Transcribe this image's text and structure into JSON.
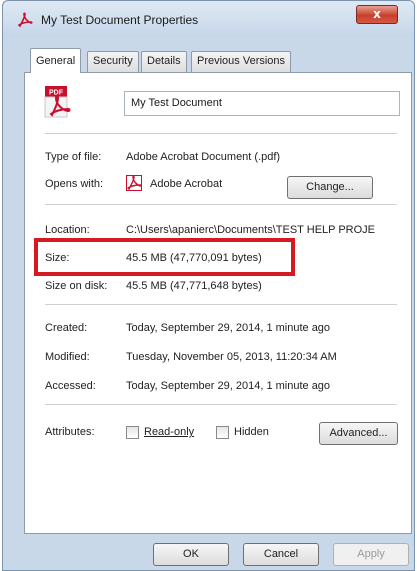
{
  "window": {
    "title": "My Test Document Properties",
    "close_glyph": "x"
  },
  "tabs": [
    {
      "label": "General",
      "active": true
    },
    {
      "label": "Security",
      "active": false
    },
    {
      "label": "Details",
      "active": false
    },
    {
      "label": "Previous Versions",
      "active": false
    }
  ],
  "general": {
    "file_name": "My Test Document",
    "file_icon": "pdf-file-icon",
    "type_label": "Type of file:",
    "type_value": "Adobe Acrobat Document (.pdf)",
    "opens_label": "Opens with:",
    "opens_value": "Adobe Acrobat",
    "change_button": "Change...",
    "location_label": "Location:",
    "location_value": "C:\\Users\\apanierc\\Documents\\TEST HELP PROJE",
    "size_label": "Size:",
    "size_value": "45.5 MB (47,770,091 bytes)",
    "size_on_disk_label": "Size on disk:",
    "size_on_disk_value": "45.5 MB (47,771,648 bytes)",
    "created_label": "Created:",
    "created_value": "Today, September 29, 2014, 1 minute ago",
    "modified_label": "Modified:",
    "modified_value": "Tuesday, November 05, 2013, 11:20:34 AM",
    "accessed_label": "Accessed:",
    "accessed_value": "Today, September 29, 2014, 1 minute ago",
    "attributes_label": "Attributes:",
    "readonly_label": "Read-only",
    "readonly_checked": false,
    "hidden_label": "Hidden",
    "hidden_checked": false,
    "advanced_button": "Advanced..."
  },
  "footer": {
    "ok": "OK",
    "cancel": "Cancel",
    "apply": "Apply"
  },
  "colors": {
    "highlight": "#d61a22",
    "window_frame": "#c9d8e8",
    "close_button": "#c7402b"
  }
}
